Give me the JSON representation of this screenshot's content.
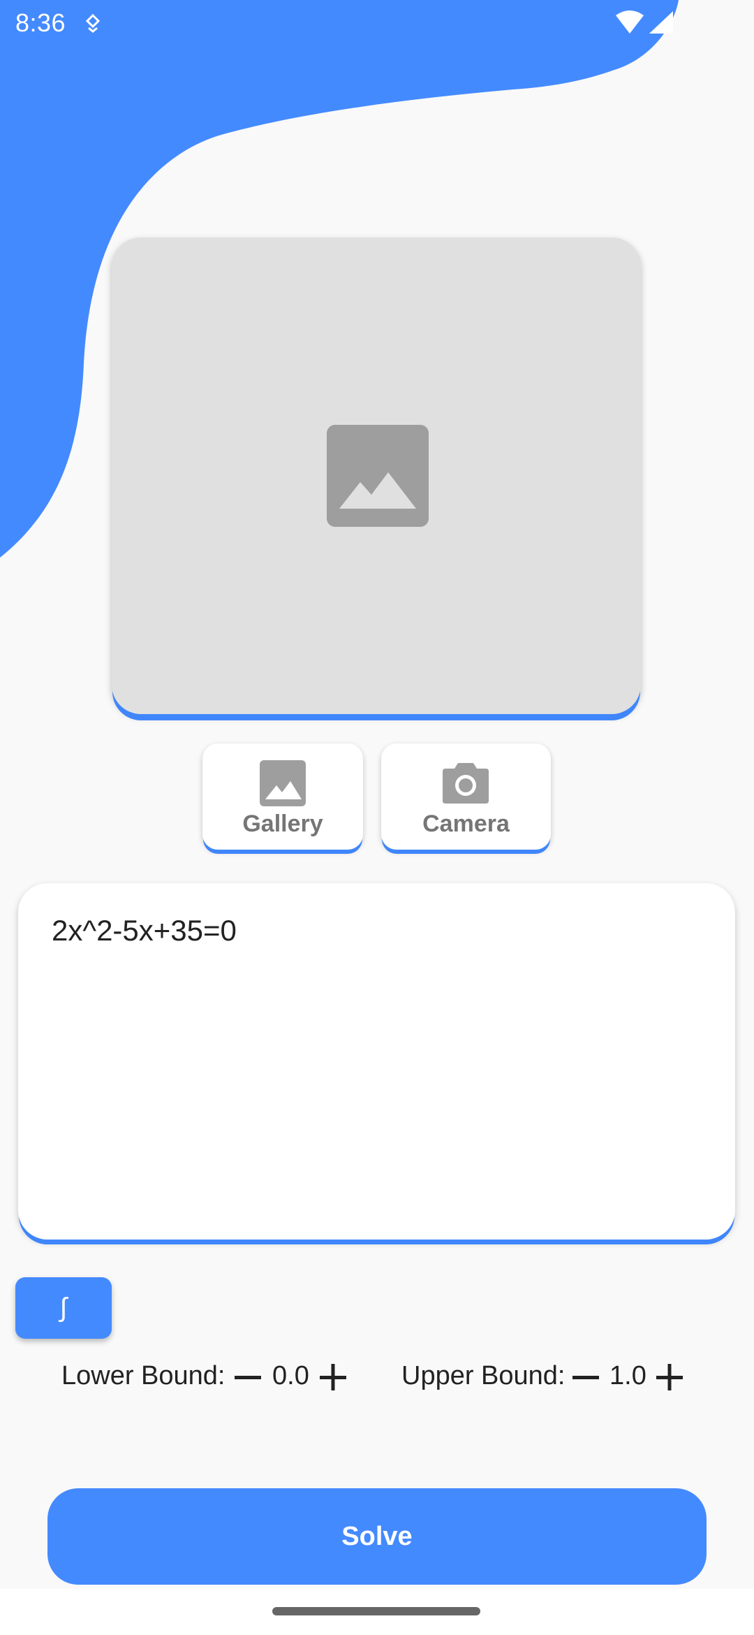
{
  "colors": {
    "accent": "#448aff",
    "background": "#f9f9f9",
    "placeholder": "#e0e0e0",
    "icon_gray": "#9e9e9e"
  },
  "status_bar": {
    "time": "8:36",
    "icons": [
      "location-icon",
      "wifi-icon",
      "signal-icon"
    ]
  },
  "image_preview": {
    "icon": "image-placeholder-icon"
  },
  "pickers": {
    "gallery": {
      "label": "Gallery",
      "icon": "image-icon"
    },
    "camera": {
      "label": "Camera",
      "icon": "camera-icon"
    }
  },
  "equation": {
    "value": "2x^2-5x+35=0"
  },
  "integral_button": {
    "label": "∫"
  },
  "bounds": {
    "lower": {
      "label": "Lower Bound:",
      "value": "0.0"
    },
    "upper": {
      "label": "Upper Bound:",
      "value": "1.0"
    }
  },
  "solve_button": {
    "label": "Solve"
  }
}
